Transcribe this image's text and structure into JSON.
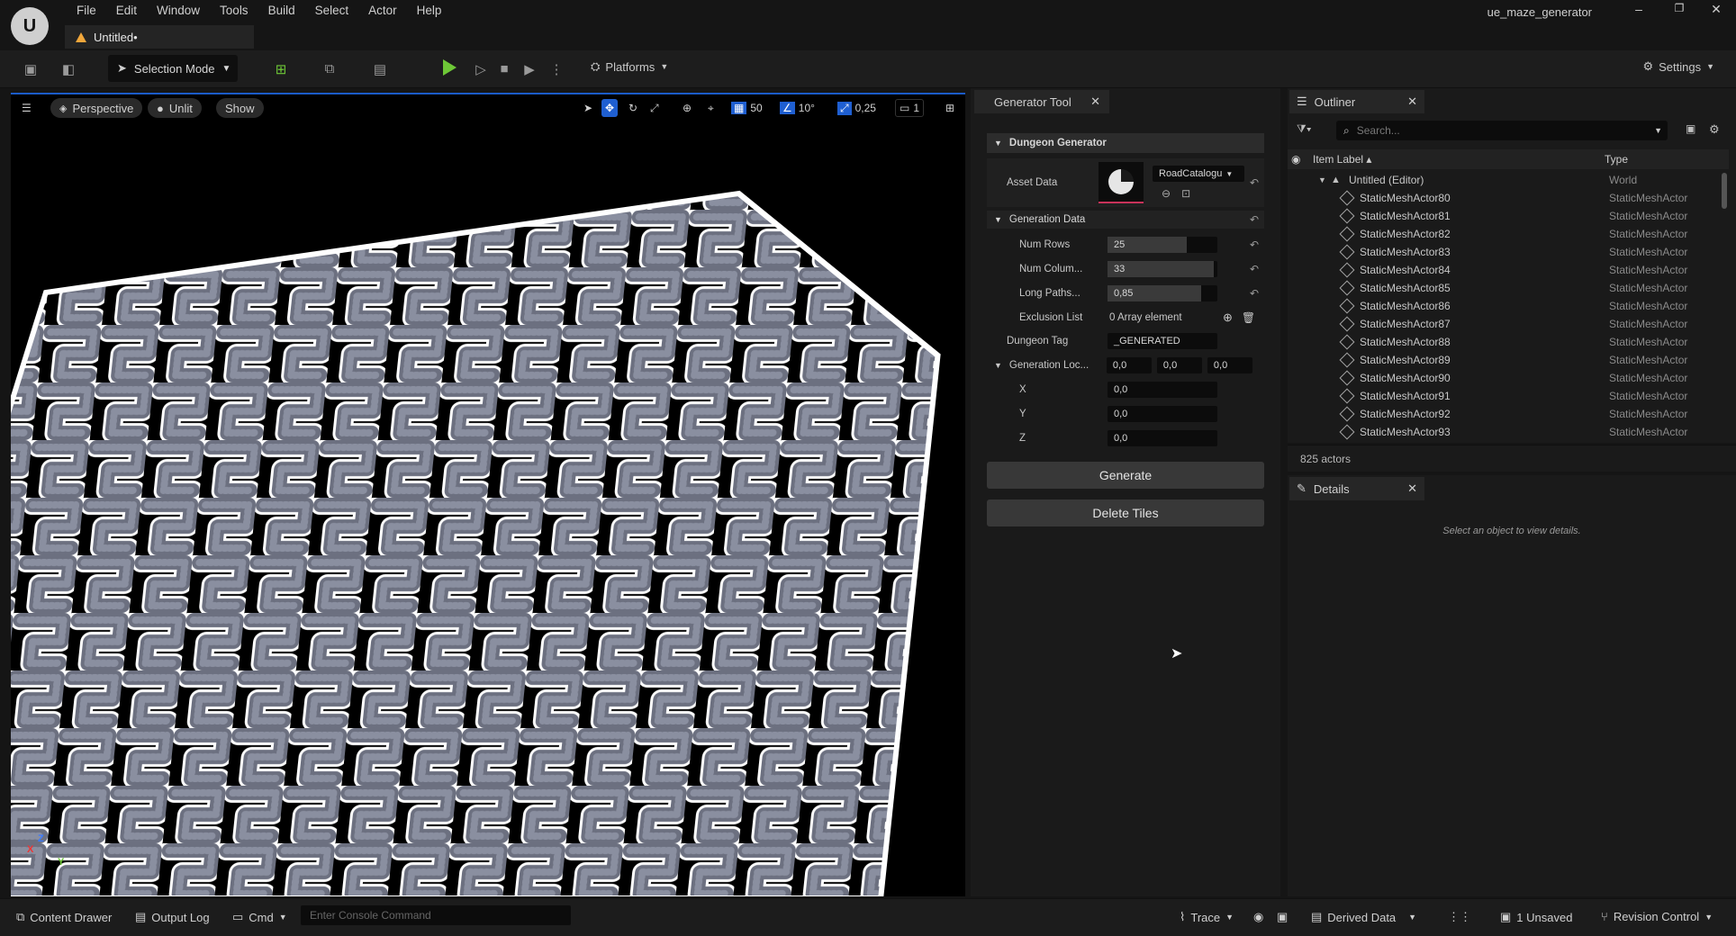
{
  "app": {
    "menu": [
      "File",
      "Edit",
      "Window",
      "Tools",
      "Build",
      "Select",
      "Actor",
      "Help"
    ],
    "doc_tab": "Untitled•",
    "project": "ue_maze_generator",
    "window_buttons": [
      "–",
      "❐",
      "✕"
    ]
  },
  "toolbar": {
    "selection_mode": "Selection Mode",
    "platforms": "Platforms",
    "settings": "Settings"
  },
  "viewport": {
    "perspective": "Perspective",
    "lit_mode": "Unlit",
    "show": "Show",
    "grid_snap": "50",
    "rot_snap": "10°",
    "scale_snap": "0,25",
    "camera_speed": "1",
    "axis_x": "X",
    "axis_y": "Y",
    "axis_z": "Z"
  },
  "generator": {
    "tab": "Generator Tool",
    "section": "Dungeon Generator",
    "asset_data_label": "Asset Data",
    "asset_dropdown": "RoadCatalogu",
    "generation_data_label": "Generation Data",
    "num_rows_label": "Num Rows",
    "num_rows": "25",
    "num_rows_fill": 0.72,
    "num_cols_label": "Num Colum...",
    "num_cols": "33",
    "num_cols_fill": 0.97,
    "long_paths_label": "Long Paths...",
    "long_paths": "0,85",
    "long_paths_fill": 0.85,
    "exclusion_label": "Exclusion List",
    "exclusion_value": "0 Array element",
    "dungeon_tag_label": "Dungeon Tag",
    "dungeon_tag": "_GENERATED",
    "gen_loc_label": "Generation Loc...",
    "loc": [
      "0,0",
      "0,0",
      "0,0"
    ],
    "x_label": "X",
    "x": "0,0",
    "y_label": "Y",
    "y": "0,0",
    "z_label": "Z",
    "z": "0,0",
    "generate": "Generate",
    "delete": "Delete Tiles"
  },
  "outliner": {
    "tab": "Outliner",
    "search_placeholder": "Search...",
    "col_label": "Item Label",
    "col_type": "Type",
    "root": "Untitled (Editor)",
    "root_type": "World",
    "rows": [
      {
        "name": "StaticMeshActor80",
        "type": "StaticMeshActor"
      },
      {
        "name": "StaticMeshActor81",
        "type": "StaticMeshActor"
      },
      {
        "name": "StaticMeshActor82",
        "type": "StaticMeshActor"
      },
      {
        "name": "StaticMeshActor83",
        "type": "StaticMeshActor"
      },
      {
        "name": "StaticMeshActor84",
        "type": "StaticMeshActor"
      },
      {
        "name": "StaticMeshActor85",
        "type": "StaticMeshActor"
      },
      {
        "name": "StaticMeshActor86",
        "type": "StaticMeshActor"
      },
      {
        "name": "StaticMeshActor87",
        "type": "StaticMeshActor"
      },
      {
        "name": "StaticMeshActor88",
        "type": "StaticMeshActor"
      },
      {
        "name": "StaticMeshActor89",
        "type": "StaticMeshActor"
      },
      {
        "name": "StaticMeshActor90",
        "type": "StaticMeshActor"
      },
      {
        "name": "StaticMeshActor91",
        "type": "StaticMeshActor"
      },
      {
        "name": "StaticMeshActor92",
        "type": "StaticMeshActor"
      },
      {
        "name": "StaticMeshActor93",
        "type": "StaticMeshActor"
      }
    ],
    "count": "825 actors"
  },
  "details": {
    "tab": "Details",
    "empty": "Select an object to view details."
  },
  "statusbar": {
    "content_drawer": "Content Drawer",
    "output_log": "Output Log",
    "cmd": "Cmd",
    "console_placeholder": "Enter Console Command",
    "trace": "Trace",
    "derived_data": "Derived Data",
    "unsaved": "1 Unsaved",
    "revision_control": "Revision Control"
  }
}
